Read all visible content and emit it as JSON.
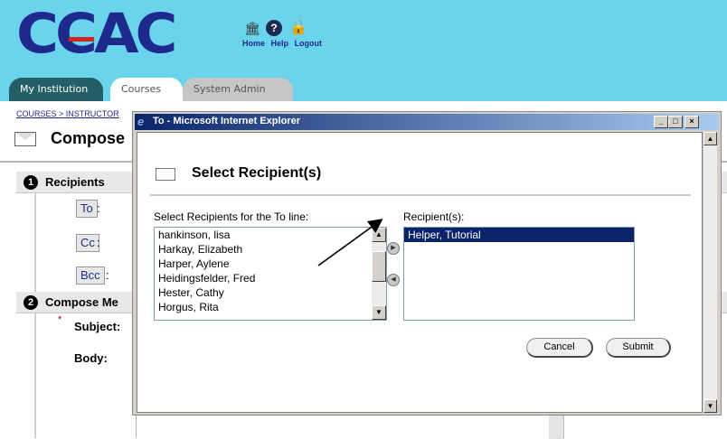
{
  "header": {
    "logo": "CCAC",
    "nav_links": [
      "Home",
      "Help",
      "Logout"
    ],
    "icons": [
      "home-icon",
      "help-icon",
      "logout-lock-icon"
    ],
    "colors": {
      "banner": "#6ad4ec",
      "logo": "#1d2a8c",
      "logo_stripe": "#d12323"
    }
  },
  "tabs": [
    {
      "label": "My Institution",
      "state": "inactive"
    },
    {
      "label": "Courses",
      "state": "active"
    },
    {
      "label": "System Admin",
      "state": "inactive"
    }
  ],
  "breadcrumb": "COURSES > INSTRUCTOR",
  "page": {
    "title": "Compose",
    "section1": {
      "number": "1",
      "label": "Recipients"
    },
    "recipient_buttons": [
      "To",
      "Cc",
      "Bcc"
    ],
    "section2": {
      "number": "2",
      "label": "Compose Me"
    },
    "subject_label": "Subject:",
    "body_label": "Body:"
  },
  "dialog": {
    "title": "To - Microsoft Internet Explorer",
    "window_buttons": {
      "min": "_",
      "max": "□",
      "close": "×"
    },
    "heading": "Select Recipient(s)",
    "left_label": "Select Recipients for the To line:",
    "right_label": "Recipient(s):",
    "available": [
      "hankinson, lisa",
      "Harkay, Elizabeth",
      "Harper, Aylene",
      "Heidingsfelder, Fred",
      "Hester, Cathy",
      "Horgus, Rita"
    ],
    "selected": [
      "Helper, Tutorial"
    ],
    "cancel_label": "Cancel",
    "submit_label": "Submit",
    "colors": {
      "selection": "#0a246a",
      "titlebar": "#0a246a"
    }
  }
}
